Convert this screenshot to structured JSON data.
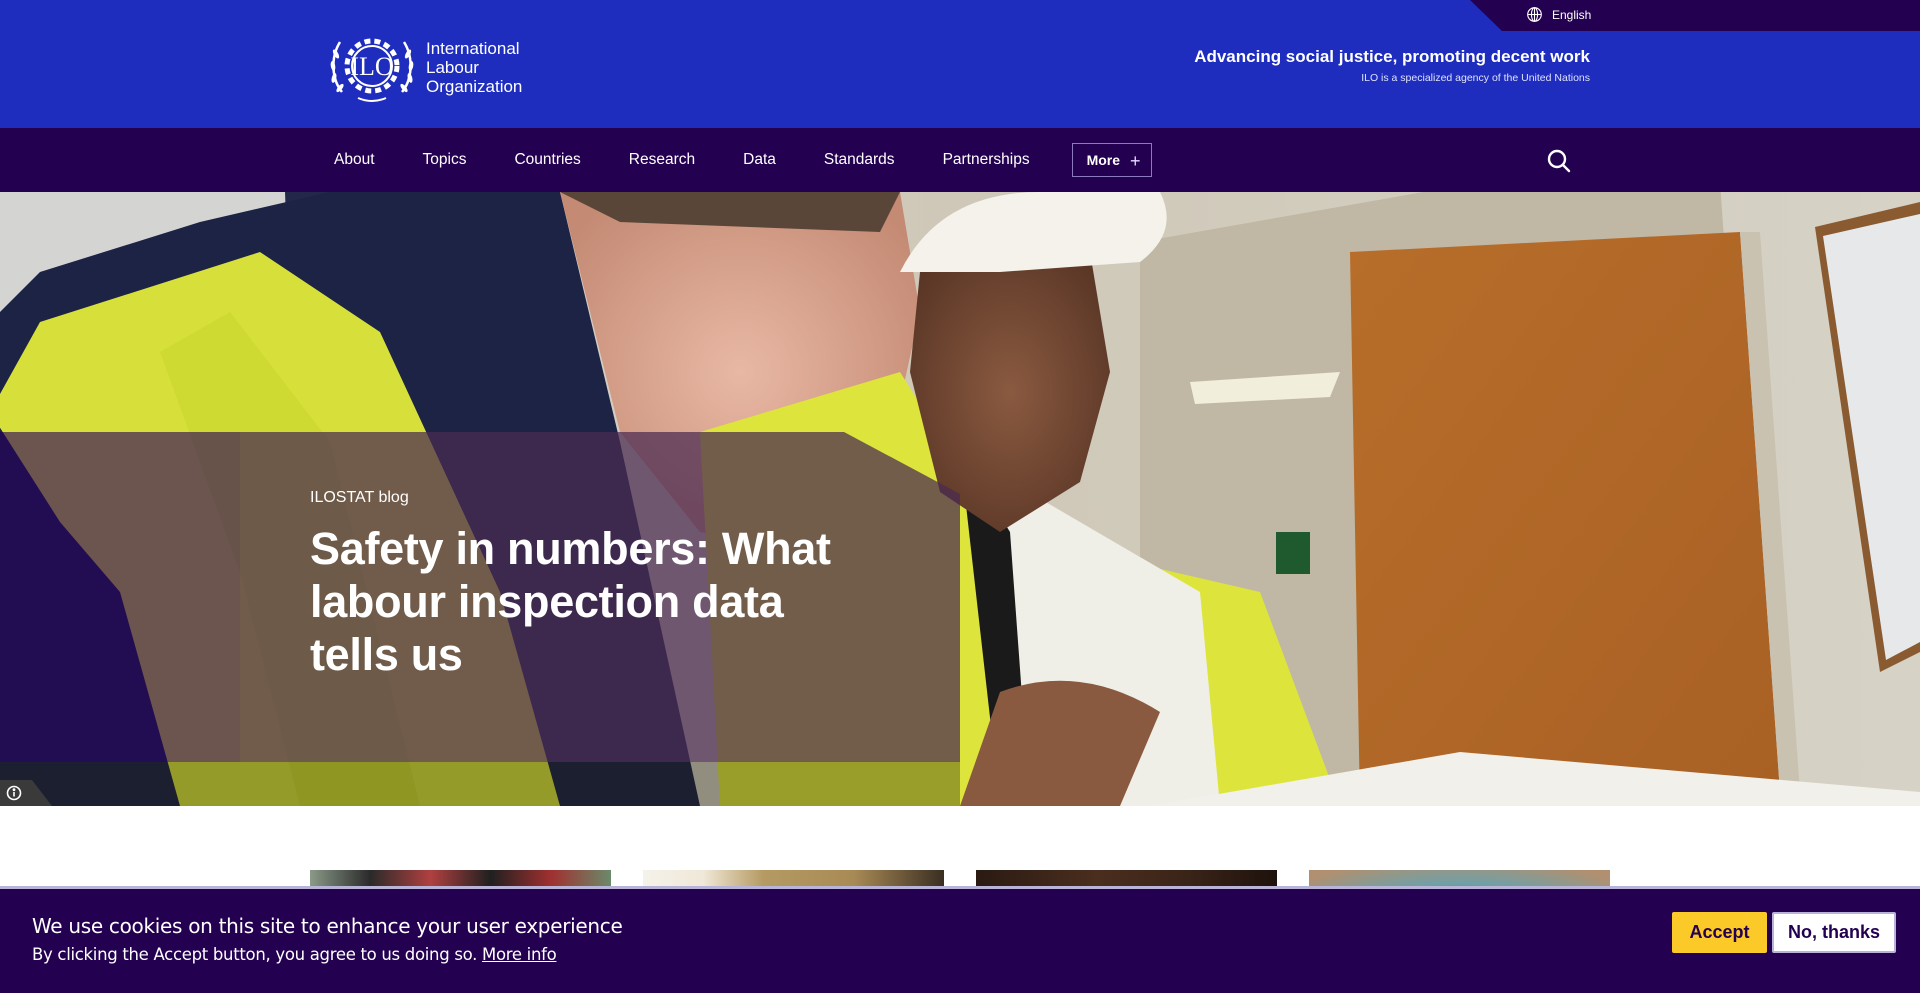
{
  "header": {
    "language": "English",
    "logo_lines": [
      "International",
      "Labour",
      "Organization"
    ],
    "tagline": "Advancing social justice, promoting decent work",
    "subtagline": "ILO is a specialized agency of the United Nations"
  },
  "nav": {
    "items": [
      {
        "label": "About"
      },
      {
        "label": "Topics"
      },
      {
        "label": "Countries"
      },
      {
        "label": "Research"
      },
      {
        "label": "Data"
      },
      {
        "label": "Standards"
      },
      {
        "label": "Partnerships"
      }
    ],
    "more_label": "More",
    "more_icon": "+"
  },
  "hero": {
    "kicker": "ILOSTAT blog",
    "title": "Safety in numbers: What labour inspection data tells us"
  },
  "cookie": {
    "title": "We use cookies on this site to enhance your user experience",
    "text": "By clicking the Accept button, you agree to us doing so.",
    "link": "More info",
    "accept": "Accept",
    "decline": "No, thanks"
  },
  "colors": {
    "brand_blue": "#1e2dbe",
    "brand_purple": "#230050",
    "accent_yellow": "#fbc928"
  }
}
